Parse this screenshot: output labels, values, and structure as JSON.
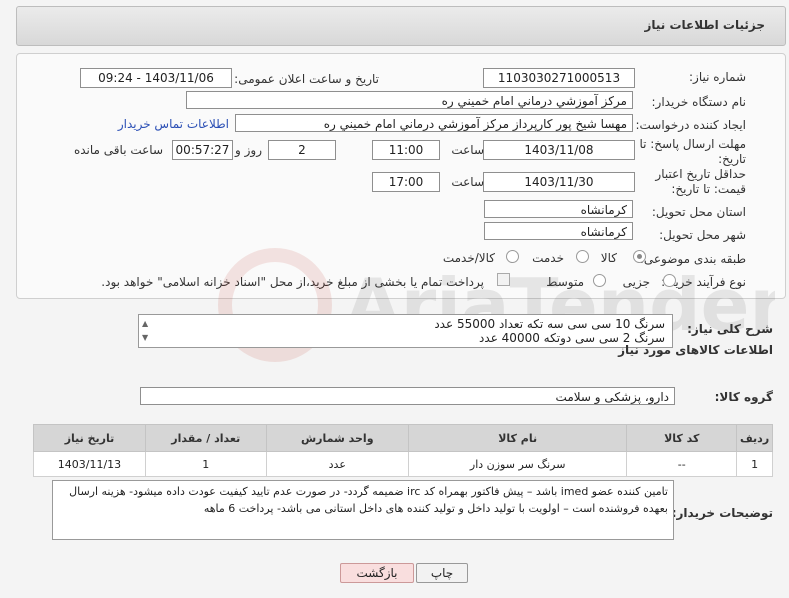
{
  "header": {
    "title": "جزئیات اطلاعات نیاز"
  },
  "form": {
    "need_number_label": "شماره نیاز:",
    "need_number": "1103030271000513",
    "announce_label": "تاریخ و ساعت اعلان عمومی:",
    "announce_value": "1403/11/06 - 09:24",
    "buyer_org_label": "نام دستگاه خریدار:",
    "buyer_org": "مرکز آموزشي درماني امام خميني ره",
    "creator_label": "ایجاد کننده درخواست:",
    "creator": "مهسا شيخ پور كارپرداز مرکز آموزشي درماني امام خميني ره",
    "contact_link": "اطلاعات تماس خریدار",
    "deadline_label": "مهلت ارسال پاسخ: تا تاریخ:",
    "deadline_date": "1403/11/08",
    "time_label": "ساعت",
    "deadline_time": "11:00",
    "days_value": "2",
    "days_label": "روز و",
    "remaining_time": "00:57:27",
    "remaining_label": "ساعت باقی مانده",
    "price_valid_label": "حداقل تاریخ اعتبار قیمت: تا تاریخ:",
    "price_valid_date": "1403/11/30",
    "price_valid_time": "17:00",
    "province_label": "استان محل تحویل:",
    "province": "کرمانشاه",
    "city_label": "شهر محل تحویل:",
    "city": "کرمانشاه",
    "category_label": "طبقه بندی موضوعی:",
    "cat_goods": "کالا",
    "cat_service": "خدمت",
    "cat_goods_service": "کالا/خدمت",
    "process_label": "نوع فرآیند خرید :",
    "proc_minor": "جزیی",
    "proc_medium": "متوسط",
    "treasury_note": "پرداخت تمام یا بخشی از مبلغ خرید،از محل \"اسناد خزانه اسلامی\" خواهد بود."
  },
  "description": {
    "label": "شرح کلی نیاز:",
    "line1": "سرنگ 10 سی سی سه تکه تعداد 55000 عدد",
    "line2": "سرنگ 2 سی سی دوتکه 40000 عدد"
  },
  "goods": {
    "section_title": "اطلاعات کالاهای مورد نیاز",
    "group_label": "گروه کالا:",
    "group_value": "دارو، پزشکی و سلامت",
    "columns": [
      "ردیف",
      "کد کالا",
      "نام کالا",
      "واحد شمارش",
      "تعداد / مقدار",
      "تاریخ نیاز"
    ],
    "rows": [
      {
        "idx": "1",
        "code": "--",
        "name": "سرنگ سر سوزن دار",
        "unit": "عدد",
        "qty": "1",
        "date": "1403/11/13"
      }
    ]
  },
  "notes": {
    "label": "توضیحات خریدار:",
    "text": "تامین کننده عضو imed باشد – پیش فاکتور بهمراه کد irc ضمیمه گردد- در صورت عدم تایید کیفیت عودت داده میشود- هزینه ارسال بعهده فروشنده است – اولویت با تولید داخل و تولید کننده های داخل استانی می باشد- پرداخت 6 ماهه"
  },
  "buttons": {
    "print": "چاپ",
    "back": "بازگشت"
  },
  "watermark": {
    "text": "AriaTender.neT"
  }
}
